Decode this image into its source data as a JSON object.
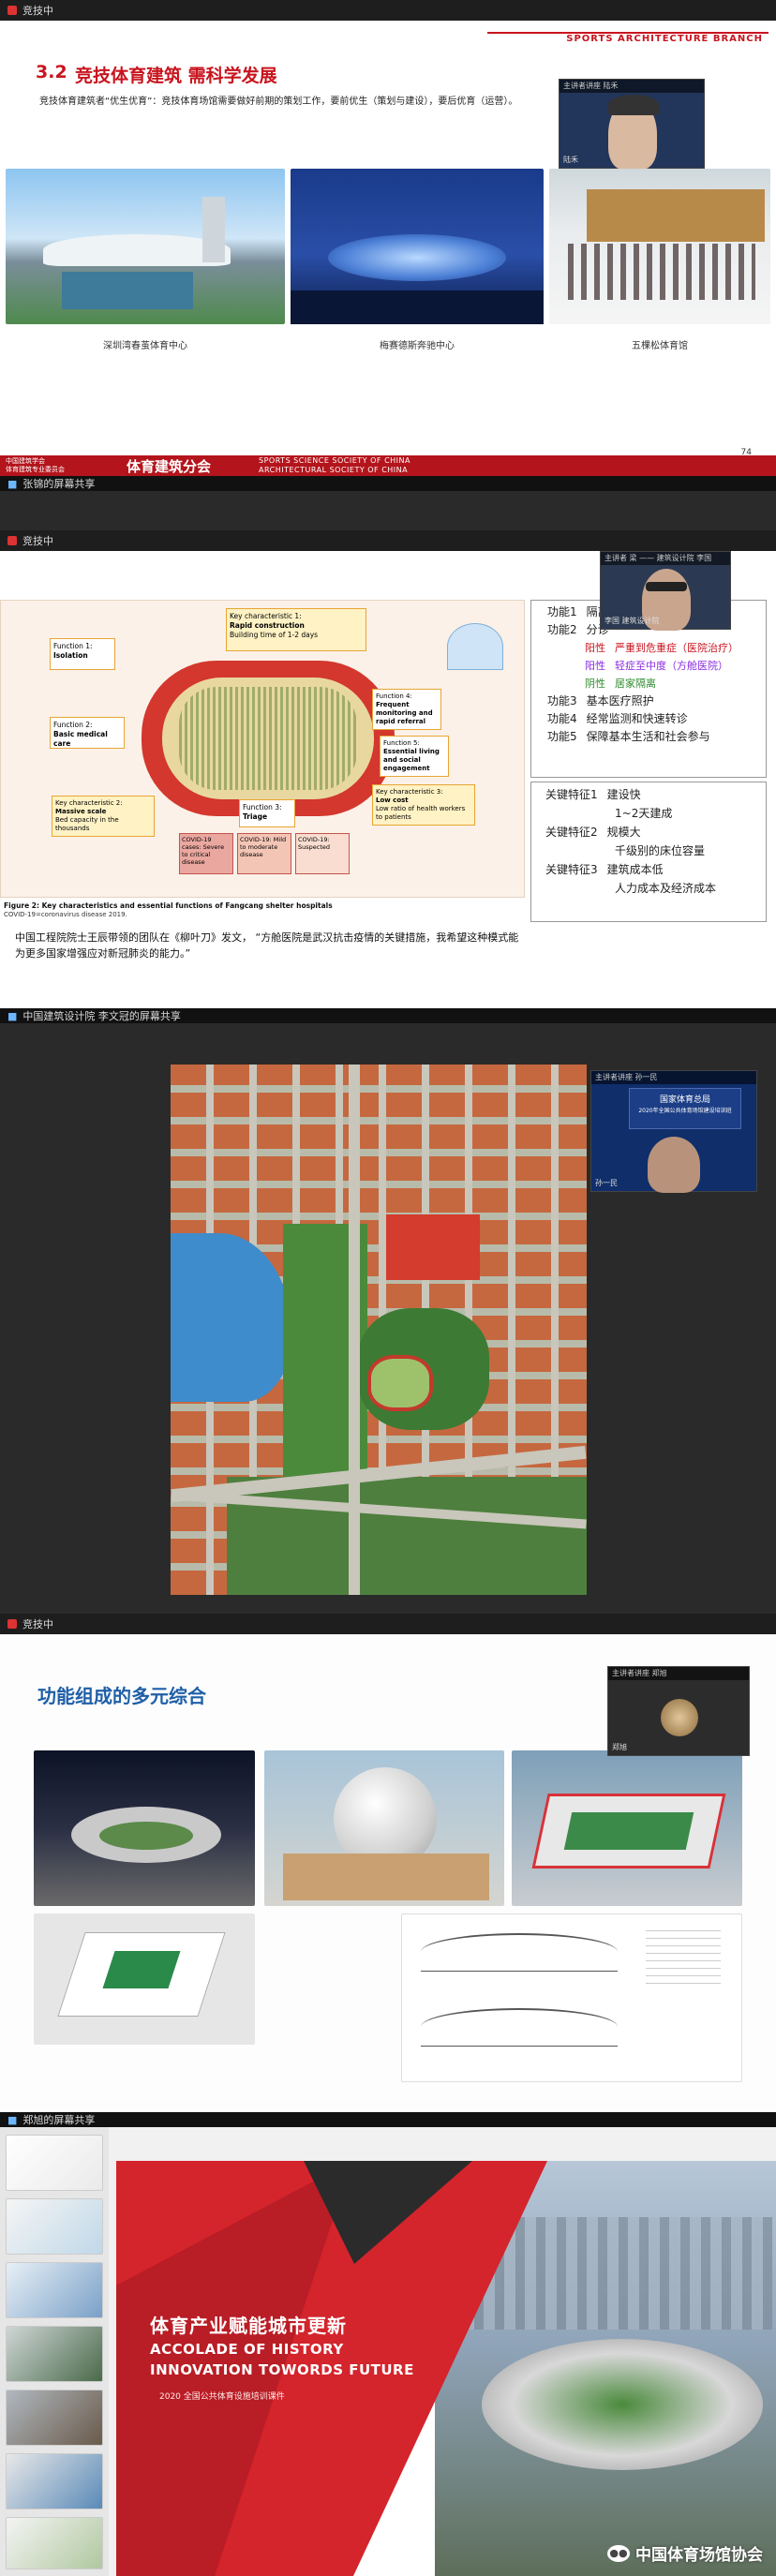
{
  "bars": {
    "top_app": "竞技中",
    "share1": "张锦的屏幕共享",
    "app2": "竞技中",
    "share2": "中国建筑设计院 李文冠的屏幕共享",
    "app3": "竞技中",
    "share3": "郑旭的屏幕共享"
  },
  "slide1": {
    "branch": "SPORTS ARCHITECTURE BRANCH",
    "title_num": "3.2",
    "title": "竞技体育建筑 需科学发展",
    "subtitle": "竞技体育建筑者“优生优育”：竞技体育场馆需要做好前期的策划工作，要前优生（策划与建设），要后优育（运营）。",
    "captions": [
      "深圳湾春茧体育中心",
      "梅赛德斯奔驰中心",
      "五棵松体育馆"
    ],
    "video_head": "主讲者讲座 陆禾",
    "video_name": "陆禾",
    "ribbon_left1": "中国建筑学会",
    "ribbon_left2": "体育建筑专业委员会",
    "ribbon_center": "体育建筑分会",
    "ribbon_right1": "SPORTS SCIENCE SOCIETY OF CHINA",
    "ribbon_right2": "ARCHITECTURAL SOCIETY OF CHINA",
    "page_num": "74"
  },
  "slide2": {
    "video_head": "主讲者 梁 —— 建筑设计院 李国",
    "video_name": "李国 建筑设计院",
    "diagram": {
      "kc1_title": "Key characteristic 1:",
      "kc1_name": "Rapid construction",
      "kc1_desc": "Building time of 1-2 days",
      "f1_title": "Function 1:",
      "f1_name": "Isolation",
      "f2_title": "Function 2:",
      "f2_name": "Basic medical care",
      "f3_title": "Function 3:",
      "f3_name": "Triage",
      "f4_title": "Function 4:",
      "f4_name": "Frequent monitoring and rapid referral",
      "f5_title": "Function 5:",
      "f5_name": "Essential living and social engagement",
      "kc2_title": "Key characteristic 2:",
      "kc2_name": "Massive scale",
      "kc2_desc": "Bed capacity in the thousands",
      "kc3_title": "Key characteristic 3:",
      "kc3_name": "Low cost",
      "kc3_desc": "Low ratio of health workers to patients",
      "c1": "COVID-19 cases: Severe to critical disease",
      "c2": "COVID-19: Mild to moderate disease",
      "c3": "COVID-19: Suspected"
    },
    "figure_caption": "Figure 2: Key characteristics and essential functions of Fangcang shelter hospitals",
    "figure_note": "COVID-19=coronavirus disease 2019.",
    "quote": "中国工程院院士王辰带领的团队在《柳叶刀》发文，  “方舱医院是武汉抗击疫情的关键措施，我希望这种模式能为更多国家增强应对新冠肺炎的能力。”",
    "functions": [
      {
        "k": "功能1",
        "v": "隔离"
      },
      {
        "k": "功能2",
        "v": "分诊"
      }
    ],
    "triage": [
      {
        "k": "阳性",
        "v": "严重到危重症（医院治疗）"
      },
      {
        "k": "阳性",
        "v": "轻症至中度（方舱医院）"
      },
      {
        "k": "阴性",
        "v": "居家隔离"
      }
    ],
    "functions2": [
      {
        "k": "功能3",
        "v": "基本医疗照护"
      },
      {
        "k": "功能4",
        "v": "经常监测和快速转诊"
      },
      {
        "k": "功能5",
        "v": "保障基本生活和社会参与"
      }
    ],
    "features": [
      {
        "k": "关键特征1",
        "v": "建设快",
        "sub": "1~2天建成"
      },
      {
        "k": "关键特征2",
        "v": "规模大",
        "sub": "千级别的床位容量"
      },
      {
        "k": "关键特征3",
        "v": "建筑成本低",
        "sub": "人力成本及经济成本"
      }
    ]
  },
  "slide3": {
    "video_head": "主讲者讲座 孙一民",
    "panel_title": "国家体育总局",
    "panel_sub": "2020年全国公共体育场馆建设培训班",
    "video_name": "孙一民"
  },
  "slide4": {
    "title": "功能组成的多元综合",
    "video_head": "主讲者讲座 郑旭",
    "video_name": "郑旭"
  },
  "slide5": {
    "title_cn": "体育产业赋能城市更新",
    "title_en1": "ACCOLADE OF HISTORY",
    "title_en2": "INNOVATION TOWORDS FUTURE",
    "subtitle": "2020 全国公共体育设施培训课件",
    "watermark": "中国体育场馆协会"
  },
  "colors": {
    "brand_red": "#c8141e",
    "title_blue": "#1f5fa8"
  },
  "icons": [
    "close-icon",
    "share-icon",
    "wechat-icon"
  ]
}
